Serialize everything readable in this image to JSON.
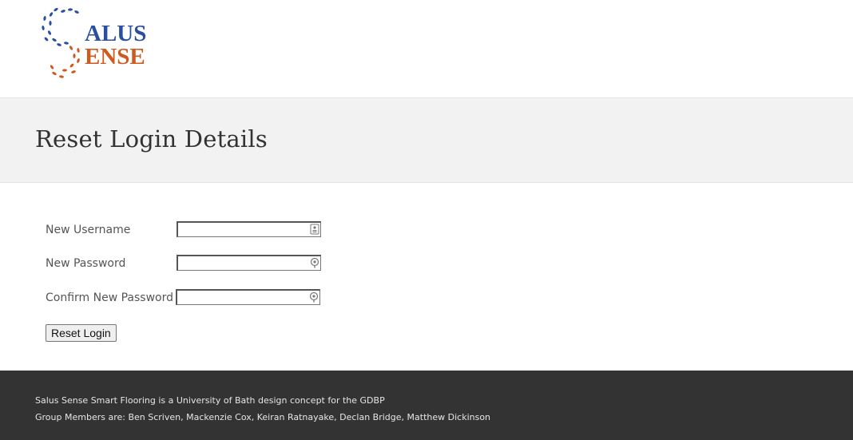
{
  "logo": {
    "line1": "ALUS",
    "line2": "ENSE",
    "colors": {
      "blue": "#2a4fa0",
      "orange": "#d05a1e"
    }
  },
  "title_band": {
    "title": "Reset Login Details"
  },
  "form": {
    "username_label": "New Username",
    "password_label": "New Password",
    "confirm_label": "Confirm New Password",
    "username_value": "",
    "password_value": "",
    "confirm_value": "",
    "submit_label": "Reset Login"
  },
  "footer": {
    "line1": "Salus Sense Smart Flooring is a University of Bath design concept for the GDBP",
    "line2": "Group Members are: Ben Scriven, Mackenzie Cox, Keiran Ratnayake, Declan Bridge, Matthew Dickinson"
  },
  "icons": {
    "username_field": "contact-card-icon",
    "password_field": "key-icon",
    "confirm_field": "key-icon"
  },
  "colors": {
    "title_band_bg": "#f2f2f2",
    "footer_bg": "#333333",
    "footer_text": "#e6e6e6"
  }
}
